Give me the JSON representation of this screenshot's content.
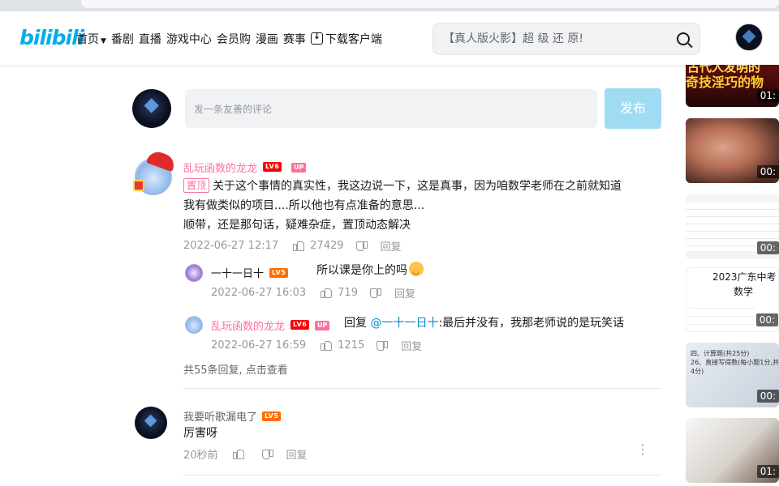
{
  "header": {
    "logo": "bilibili",
    "nav": [
      {
        "name": "nav-home",
        "label": "首页"
      },
      {
        "name": "nav-bangumi",
        "label": "番剧"
      },
      {
        "name": "nav-live",
        "label": "直播"
      },
      {
        "name": "nav-game-center",
        "label": "游戏中心"
      },
      {
        "name": "nav-vip-shop",
        "label": "会员购"
      },
      {
        "name": "nav-manga",
        "label": "漫画"
      },
      {
        "name": "nav-esports",
        "label": "赛事"
      }
    ],
    "download_label": "下载客户端",
    "search_placeholder": "【真人版火影】超 级 还 原!"
  },
  "compose": {
    "placeholder": "发一条友善的评论",
    "publish_label": "发布"
  },
  "comments": [
    {
      "username": "乱玩函数的龙龙",
      "level": "LV6",
      "up_badge": "UP",
      "pin_label": "置顶",
      "text_line1": "关于这个事情的真实性，我这边说一下，这是真事，因为咱数学老师在之前就知道",
      "text_line2": "我有做类似的项目....所以他也有点准备的意思...",
      "text_line3": "顺带，还是那句话，疑难杂症，置顶动态解决",
      "date": "2022-06-27 12:17",
      "likes": "27429",
      "reply_label": "回复",
      "replies": [
        {
          "username": "一十一日十",
          "level": "LV5",
          "text": "所以课是你上的吗",
          "date": "2022-06-27 16:03",
          "likes": "719",
          "reply_label": "回复"
        },
        {
          "username": "乱玩函数的龙龙",
          "level": "LV6",
          "up_badge": "UP",
          "reply_prefix": "回复 ",
          "mention": "@一十一日十",
          "text": ":最后并没有，我那老师说的是玩笑话",
          "date": "2022-06-27 16:59",
          "likes": "1215",
          "reply_label": "回复"
        }
      ],
      "more_replies": "共55条回复, 点击查看"
    },
    {
      "username": "我要听歌漏电了",
      "level": "LV5",
      "text": "厉害呀",
      "date": "20秒前",
      "reply_label": "回复"
    }
  ],
  "sidebar": {
    "cards": [
      {
        "title_line1": "古代人发明的",
        "title_line2": "奇技淫巧的物",
        "duration": "01:"
      },
      {
        "duration": "00:"
      },
      {
        "duration": "00:"
      },
      {
        "title_line1": "2023广东中考",
        "title_line2": "数学",
        "duration": "00:"
      },
      {
        "snippet": "四、计算题(共25分)\n26、直接写得数(每小题1分,共4分)",
        "duration": "00:"
      },
      {
        "duration": "01:"
      }
    ]
  }
}
